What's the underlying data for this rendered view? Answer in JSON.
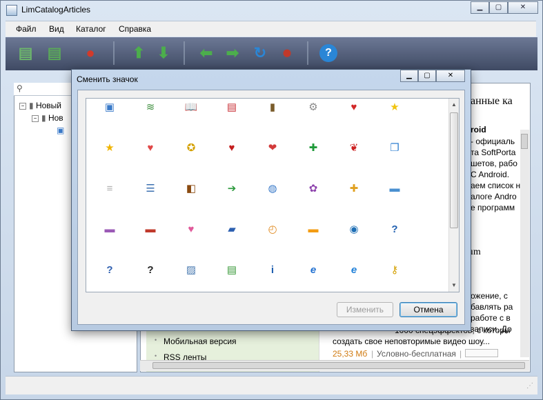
{
  "window": {
    "title": "LimCatalogArticles",
    "minimize_glyph": "▁",
    "maximize_glyph": "▢",
    "close_glyph": "✕"
  },
  "menu": {
    "file": "Файл",
    "view": "Вид",
    "catalog": "Каталог",
    "help": "Справка"
  },
  "toolbar": {
    "icons": [
      "add-catalog-icon",
      "add-item-icon",
      "delete-icon",
      "up-arrow-icon",
      "down-arrow-icon",
      "back-arrow-icon",
      "forward-arrow-icon",
      "refresh-icon",
      "stop-icon",
      "help-icon"
    ]
  },
  "tree": {
    "root_label": "Новый",
    "child_label": "Нов"
  },
  "article": {
    "heading": "анные ка",
    "sub": "roid",
    "lines": [
      "- официаль",
      "та SoftPorta",
      "шетов, рабо",
      "C Android.",
      "аем список н",
      "алоге Andro",
      "е программ"
    ],
    "sub2": "ım",
    "lines2": [
      "ожение, с",
      "бавлять ра",
      "работе с в",
      "записи. До"
    ],
    "desc_line": "1000 спецэффектов, с которы",
    "desc_line2": "создать свое неповторимые видео шоу...",
    "size": "25,33 Мб",
    "license": "Условно-бесплатная",
    "sep": "|",
    "nav_mobile": "Мобильная версия",
    "nav_rss": "RSS ленты",
    "bullet": "•"
  },
  "dialog": {
    "title": "Сменить значок",
    "change_button": "Изменить",
    "cancel_button": "Отмена",
    "icons": [
      {
        "name": "picture-window-icon",
        "glyph": "▣",
        "color": "#3a7ac9"
      },
      {
        "name": "books-stack-icon",
        "glyph": "≋",
        "color": "#3f8f3f"
      },
      {
        "name": "open-book-icon",
        "glyph": "📖",
        "color": "#2f6fb5"
      },
      {
        "name": "notebook-icon",
        "glyph": "▤",
        "color": "#c9343a"
      },
      {
        "name": "brown-book-icon",
        "glyph": "▮",
        "color": "#7a5c2b"
      },
      {
        "name": "gear-icon",
        "glyph": "⚙",
        "color": "#8a8a8a"
      },
      {
        "name": "heart-badge-icon",
        "glyph": "♥",
        "color": "#d22828"
      },
      {
        "name": "star-icon",
        "glyph": "★",
        "color": "#f1c40f"
      },
      {
        "name": "star-outline-icon",
        "glyph": "★",
        "color": "#f0b400"
      },
      {
        "name": "heart-red-icon",
        "glyph": "♥",
        "color": "#e04848"
      },
      {
        "name": "star-box-icon",
        "glyph": "✪",
        "color": "#d4a000"
      },
      {
        "name": "heart-dark-icon",
        "glyph": "♥",
        "color": "#c41e1e"
      },
      {
        "name": "heart-circle-icon",
        "glyph": "❤",
        "color": "#d23a3a"
      },
      {
        "name": "add-document-icon",
        "glyph": "✚",
        "color": "#1f9a3a"
      },
      {
        "name": "document-heart-icon",
        "glyph": "❦",
        "color": "#cc2222"
      },
      {
        "name": "copy-document-icon",
        "glyph": "❐",
        "color": "#2f7fd0"
      },
      {
        "name": "blank-document-icon",
        "glyph": "≡",
        "color": "#b0b0b0"
      },
      {
        "name": "document-list-icon",
        "glyph": "☰",
        "color": "#3a6fb0"
      },
      {
        "name": "book-brown-icon",
        "glyph": "◧",
        "color": "#8a4a10"
      },
      {
        "name": "document-arrow-icon",
        "glyph": "➔",
        "color": "#2e9a3e"
      },
      {
        "name": "document-globe-icon",
        "glyph": "◍",
        "color": "#3a7ac9"
      },
      {
        "name": "settings-document-icon",
        "glyph": "✿",
        "color": "#8e44ad"
      },
      {
        "name": "folder-add-icon",
        "glyph": "✚",
        "color": "#e0a020"
      },
      {
        "name": "folder-blue-icon",
        "glyph": "▬",
        "color": "#4a90d0"
      },
      {
        "name": "folder-purple-icon",
        "glyph": "▬",
        "color": "#9b59b6"
      },
      {
        "name": "folder-red-icon",
        "glyph": "▬",
        "color": "#c0392b"
      },
      {
        "name": "folder-heart-icon",
        "glyph": "♥",
        "color": "#e05a9a"
      },
      {
        "name": "folder-open-blue-icon",
        "glyph": "▰",
        "color": "#2c5fb0"
      },
      {
        "name": "folder-clock-icon",
        "glyph": "◴",
        "color": "#e08a20"
      },
      {
        "name": "folder-orange-icon",
        "glyph": "▬",
        "color": "#f39c12"
      },
      {
        "name": "globe-tool-icon",
        "glyph": "◉",
        "color": "#1f6fb5"
      },
      {
        "name": "question-circle-icon",
        "glyph": "?",
        "color": "#1f5fb0"
      },
      {
        "name": "help-book-icon",
        "glyph": "?",
        "color": "#2f5fb0"
      },
      {
        "name": "question-mark-icon",
        "glyph": "?",
        "color": "#222222"
      },
      {
        "name": "image-icon",
        "glyph": "▨",
        "color": "#4a7ab0"
      },
      {
        "name": "landscape-icon",
        "glyph": "▤",
        "color": "#3a9a3a"
      },
      {
        "name": "info-icon",
        "glyph": "i",
        "color": "#1f5fb0"
      },
      {
        "name": "internet-explorer-icon",
        "glyph": "e",
        "color": "#1f6fd0"
      },
      {
        "name": "internet-explorer-blue-icon",
        "glyph": "e",
        "color": "#1e7fd8"
      },
      {
        "name": "key-icon",
        "glyph": "⚷",
        "color": "#d4a000"
      }
    ]
  }
}
